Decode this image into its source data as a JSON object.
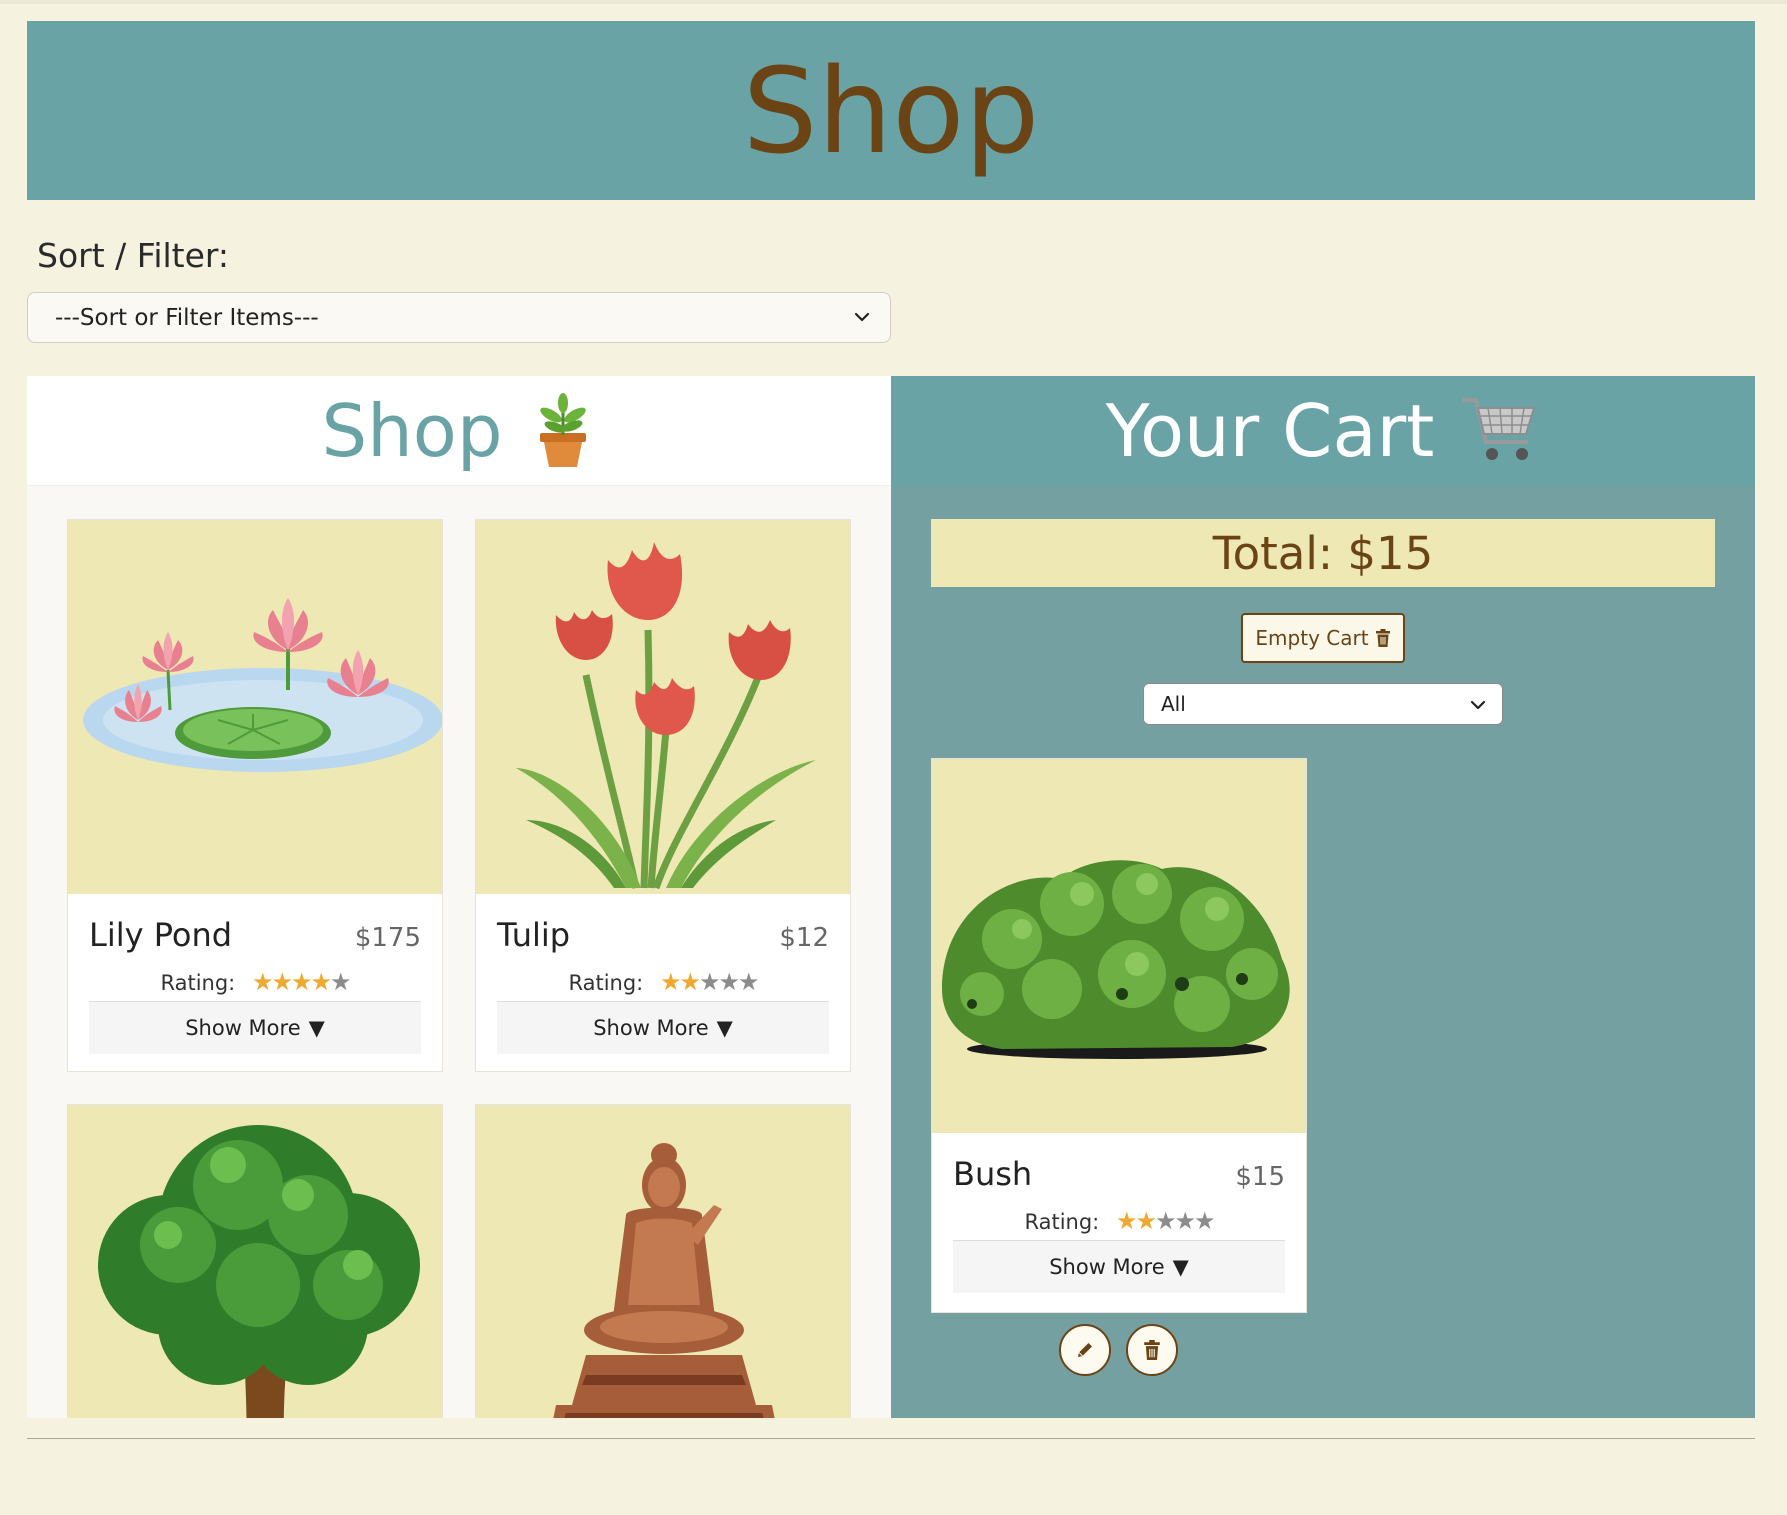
{
  "banner": {
    "title": "Shop"
  },
  "sort": {
    "label": "Sort / Filter:",
    "selected": "---Sort or Filter Items---"
  },
  "shop": {
    "title": "Shop",
    "items": [
      {
        "name": "Lily Pond",
        "price": "$175",
        "rating_label": "Rating:",
        "rating": 4,
        "max_rating": 5,
        "show_more": "Show More"
      },
      {
        "name": "Tulip",
        "price": "$12",
        "rating_label": "Rating:",
        "rating": 2,
        "max_rating": 5,
        "show_more": "Show More"
      },
      {
        "name": "",
        "image": "tree"
      },
      {
        "name": "",
        "image": "buddha-statue"
      }
    ]
  },
  "cart": {
    "title": "Your Cart",
    "total": "Total: $15",
    "empty_label": "Empty Cart",
    "filter_selected": "All",
    "items": [
      {
        "name": "Bush",
        "price": "$15",
        "rating_label": "Rating:",
        "rating": 2,
        "max_rating": 5,
        "show_more": "Show More"
      }
    ]
  },
  "colors": {
    "background": "#f5f3df",
    "teal": "#6aa3a6",
    "brown": "#6b4416",
    "card_image_bg": "#eee8b5",
    "star_on": "#efa930",
    "star_off": "#8c8c8c"
  },
  "icons": [
    "chevron-down-icon",
    "potted-plant-icon",
    "shopping-cart-icon",
    "trash-icon",
    "pencil-icon",
    "triangle-down-icon"
  ]
}
